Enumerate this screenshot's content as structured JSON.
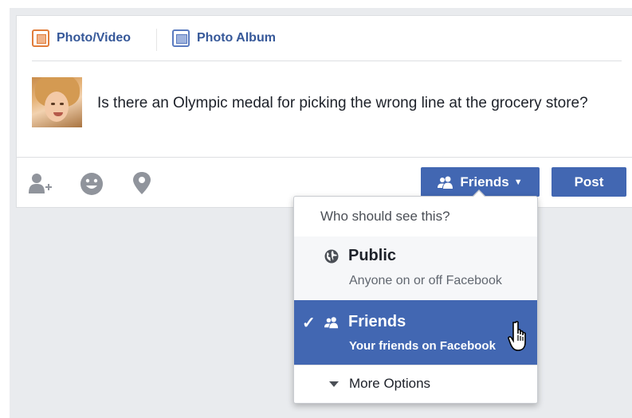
{
  "tabs": {
    "photo_video": "Photo/Video",
    "photo_album": "Photo Album"
  },
  "post": {
    "text": "Is there an Olympic medal for picking the wrong line at the grocery store?"
  },
  "actions": {
    "audience_label": "Friends",
    "post_label": "Post"
  },
  "audience_menu": {
    "header": "Who should see this?",
    "options": [
      {
        "title": "Public",
        "subtitle": "Anyone on or off Facebook",
        "icon": "globe-icon",
        "selected": false
      },
      {
        "title": "Friends",
        "subtitle": "Your friends on Facebook",
        "icon": "friends-icon",
        "selected": true
      }
    ],
    "more_label": "More Options"
  },
  "colors": {
    "brand_blue": "#4267b2",
    "link_blue": "#365899",
    "photo_orange": "#e17d3b",
    "icon_gray": "#90949c",
    "page_bg": "#e9ebee"
  }
}
